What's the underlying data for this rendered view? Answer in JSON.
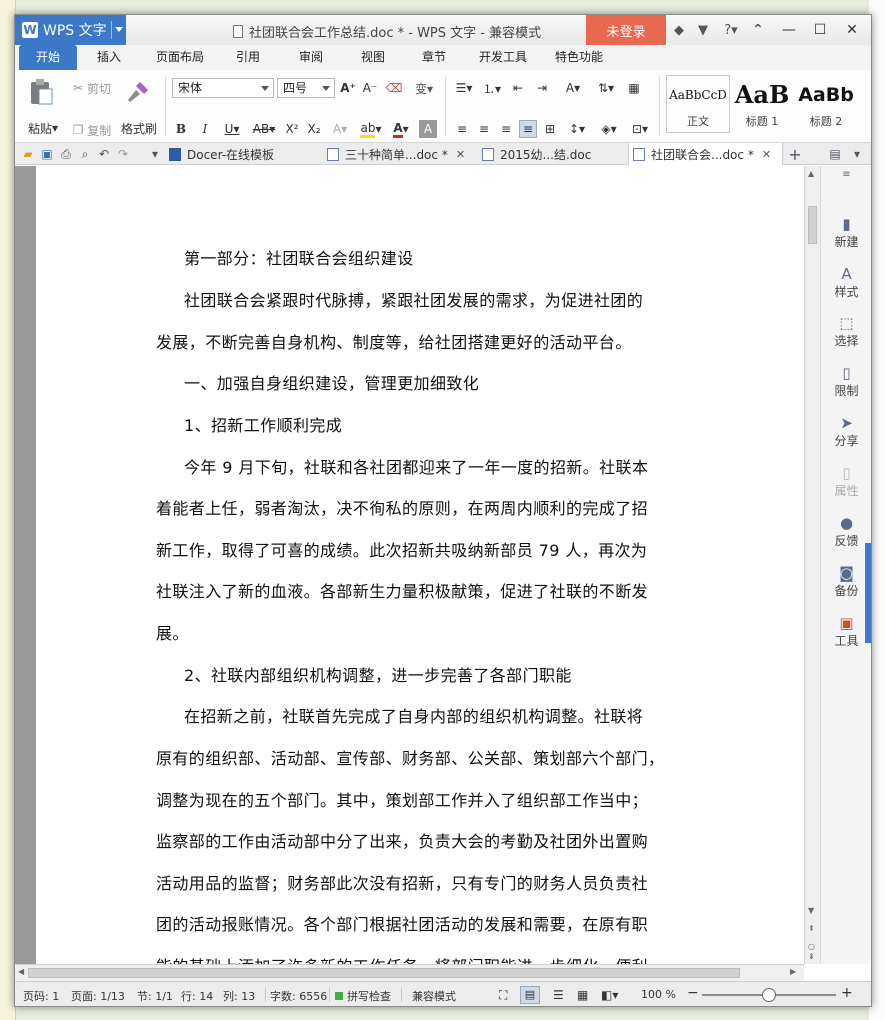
{
  "window": {
    "app_name": "WPS 文字",
    "title": "社团联合会工作总结.doc * - WPS 文字 - 兼容模式",
    "login_label": "未登录"
  },
  "ribbon_tabs": [
    "开始",
    "插入",
    "页面布局",
    "引用",
    "审阅",
    "视图",
    "章节",
    "开发工具",
    "特色功能"
  ],
  "ribbon": {
    "paste": "粘贴",
    "cut": "剪切",
    "copy": "复制",
    "format_painter": "格式刷",
    "font_name": "宋体",
    "font_size": "四号",
    "styles": [
      {
        "sample": "AaBbCcD",
        "caption": "正文"
      },
      {
        "sample": "AaB",
        "caption": "标题 1"
      },
      {
        "sample": "AaBb",
        "caption": "标题 2"
      }
    ]
  },
  "doc_tabs": [
    {
      "label": "Docer-在线模板"
    },
    {
      "label": "三十种简单...doc *"
    },
    {
      "label": "2015幼...结.doc"
    },
    {
      "label": "社团联合会...doc *"
    }
  ],
  "document": {
    "paragraphs": [
      "第一部分：社团联合会组织建设",
      "社团联合会紧跟时代脉搏，紧跟社团发展的需求，为促进社团的",
      "发展，不断完善自身机构、制度等，给社团搭建更好的活动平台。",
      "一、加强自身组织建设，管理更加细致化",
      "1、招新工作顺利完成",
      "今年 9 月下旬，社联和各社团都迎来了一年一度的招新。社联本",
      "着能者上任，弱者淘汰，决不徇私的原则，在两周内顺利的完成了招",
      "新工作，取得了可喜的成绩。此次招新共吸纳新部员 79 人，再次为",
      "社联注入了新的血液。各部新生力量积极献策，促进了社联的不断发",
      "展。",
      "2、社联内部组织机构调整，进一步完善了各部门职能",
      "在招新之前，社联首先完成了自身内部的组织机构调整。社联将",
      "原有的组织部、活动部、宣传部、财务部、公关部、策划部六个部门，",
      "调整为现在的五个部门。其中，策划部工作并入了组织部工作当中；",
      "监察部的工作由活动部中分了出来，负责大会的考勤及社团外出置购",
      "活动用品的监督；财务部此次没有招新，只有专门的财务人员负责社",
      "团的活动报账情况。各个部门根据社团活动的发展和需要，在原有职",
      "能的基础上添加了许多新的工作任务，将部门职能进一步细化，便利"
    ]
  },
  "sidebar": [
    "新建",
    "样式",
    "选择",
    "限制",
    "分享",
    "属性",
    "反馈",
    "备份",
    "工具"
  ],
  "status": {
    "page_code": "页码: 1",
    "pages": "页面: 1/13",
    "section": "节: 1/1",
    "row": "行: 14",
    "col": "列: 13",
    "word_count": "字数: 6556",
    "spellcheck": "拼写检查",
    "compat": "兼容模式",
    "zoom": "100 %",
    "zoom_fraction": 0.5
  },
  "colors": {
    "accent": "#3b78c7",
    "login": "#e8694f"
  }
}
